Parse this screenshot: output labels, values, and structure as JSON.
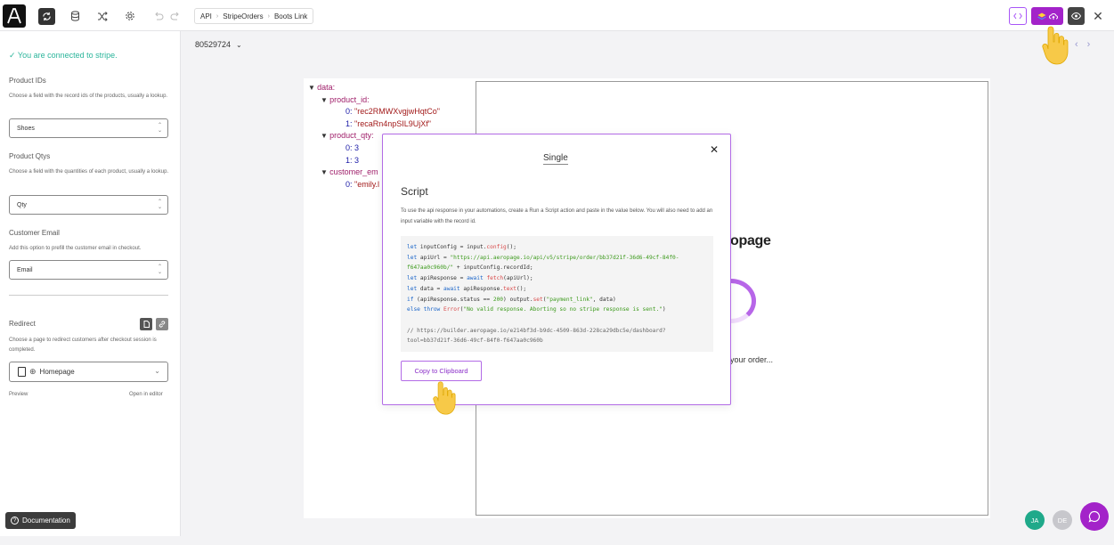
{
  "topbar": {
    "breadcrumb": [
      "API",
      "StripeOrders",
      "Boots Link"
    ]
  },
  "sidebar": {
    "connected_text": "You are connected to stripe.",
    "product_ids": {
      "label": "Product IDs",
      "help": "Choose a field with the record ids of the products, usually a lookup.",
      "value": "Shoes"
    },
    "product_qtys": {
      "label": "Product Qtys",
      "help": "Choose a field with the quantities of each product, usually a lookup.",
      "value": "Qty"
    },
    "customer_email": {
      "label": "Customer Email",
      "help": "Add this option to prefill the customer email in checkout.",
      "value": "Email"
    },
    "redirect": {
      "label": "Redirect",
      "help": "Choose a page to redirect customers after checkout session is completed.",
      "value": "Homepage",
      "preview_link": "Preview",
      "editor_link": "Open in editor"
    },
    "documentation_label": "Documentation"
  },
  "main": {
    "record_id": "80529724",
    "json_lines": [
      {
        "indent": 0,
        "arrow": "▼",
        "key": "data:",
        "value": ""
      },
      {
        "indent": 1,
        "arrow": "▼",
        "key": "product_id:",
        "value": ""
      },
      {
        "indent": 2,
        "arrow": "",
        "key": "0:",
        "value": "\"rec2RMWXvgjwHqtCo\""
      },
      {
        "indent": 2,
        "arrow": "",
        "key": "1:",
        "value": "\"recaRn4npSIL9UjXf\""
      },
      {
        "indent": 1,
        "arrow": "▼",
        "key": "product_qty:",
        "value": ""
      },
      {
        "indent": 2,
        "arrow": "",
        "key": "0:",
        "value": "3"
      },
      {
        "indent": 2,
        "arrow": "",
        "key": "1:",
        "value": "3"
      },
      {
        "indent": 1,
        "arrow": "▼",
        "key": "customer_em",
        "value": ""
      },
      {
        "indent": 2,
        "arrow": "",
        "key": "0:",
        "value": "\"emily.l"
      }
    ],
    "preview_brand_fragment": "opage",
    "preview_order_fragment": "your order..."
  },
  "modal": {
    "tab_label": "Single",
    "title": "Script",
    "description": "To use the api response in your automations, create a Run a Script action and paste in the value below. You will also need to add an input variable with the record id.",
    "copy_button_label": "Copy to Clipboard"
  },
  "collaborators": [
    {
      "initials": "JA",
      "color": "#1fa98a"
    },
    {
      "initials": "DE",
      "color": "#c7c7cc"
    }
  ],
  "colors": {
    "accent": "#a323c9",
    "connected": "#2bb59b"
  }
}
